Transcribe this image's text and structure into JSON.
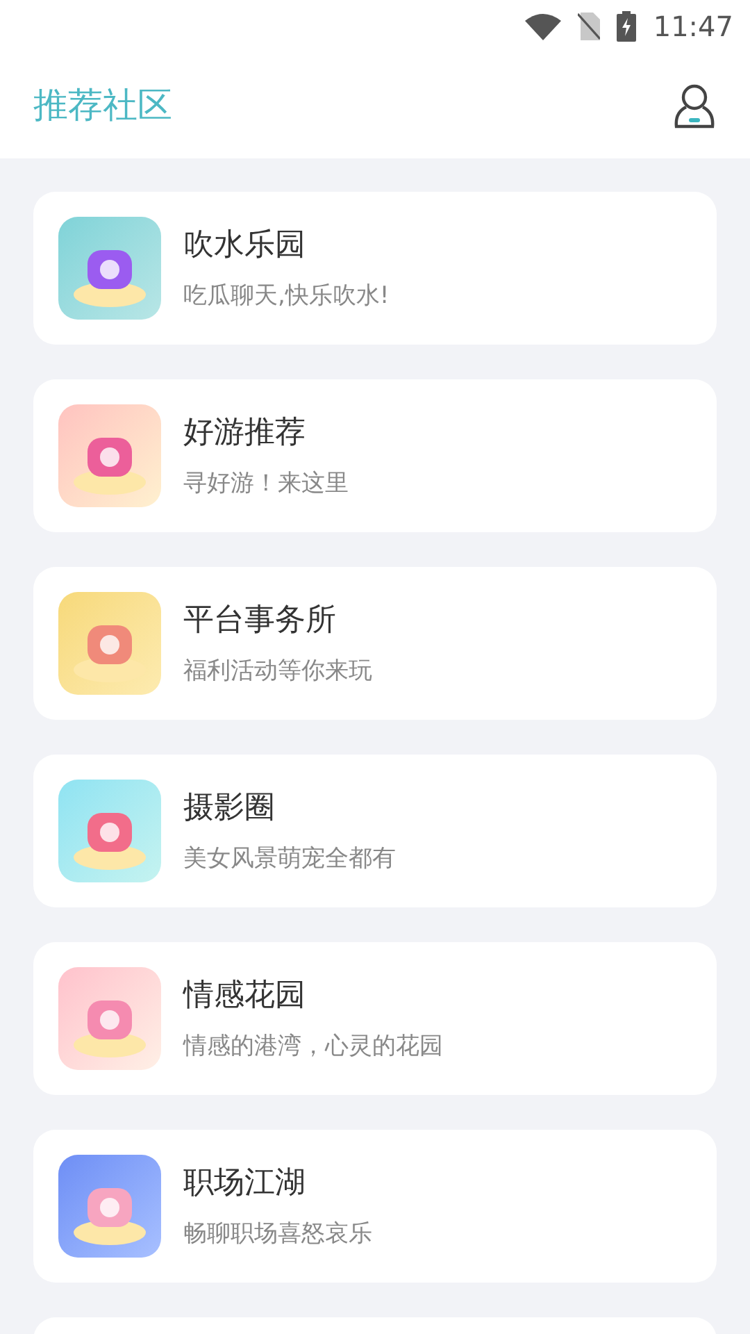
{
  "status_bar": {
    "time": "11:47"
  },
  "header": {
    "title": "推荐社区"
  },
  "communities": [
    {
      "title": "吹水乐园",
      "subtitle": "吃瓜聊天,快乐吹水!"
    },
    {
      "title": "好游推荐",
      "subtitle": "寻好游！来这里"
    },
    {
      "title": "平台事务所",
      "subtitle": "福利活动等你来玩"
    },
    {
      "title": "摄影圈",
      "subtitle": "美女风景萌宠全都有"
    },
    {
      "title": "情感花园",
      "subtitle": "情感的港湾，心灵的花园"
    },
    {
      "title": "职场江湖",
      "subtitle": "畅聊职场喜怒哀乐"
    }
  ]
}
